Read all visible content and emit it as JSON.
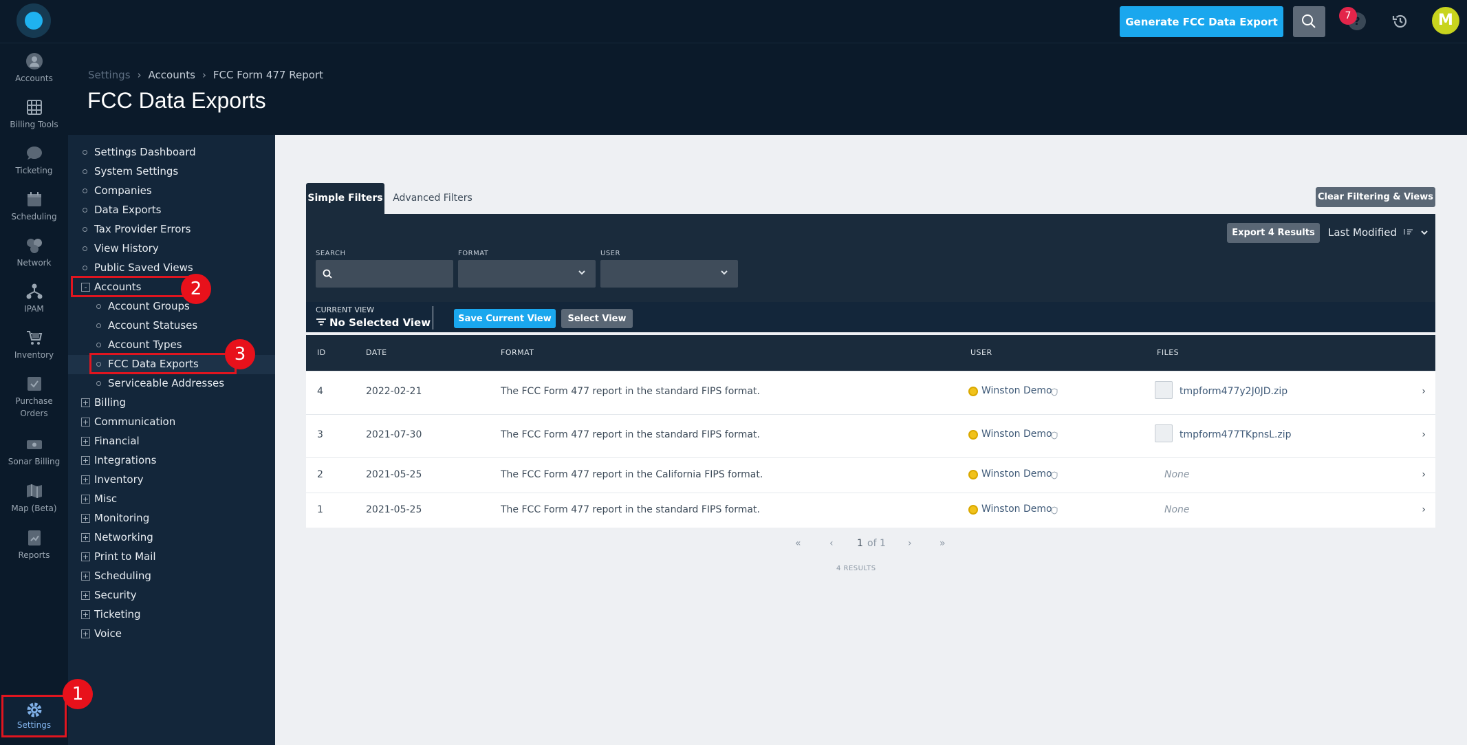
{
  "topbar": {
    "generate_label": "Generate FCC Data Export",
    "notification_count": "7",
    "help_glyph": "?",
    "avatar_initial": "M"
  },
  "rail": {
    "items": [
      {
        "label": "Accounts",
        "icon": "user-icon"
      },
      {
        "label": "Billing Tools",
        "icon": "abacus-icon"
      },
      {
        "label": "Ticketing",
        "icon": "chat-bubble-icon"
      },
      {
        "label": "Scheduling",
        "icon": "calendar-icon"
      },
      {
        "label": "Network",
        "icon": "network-icon"
      },
      {
        "label": "IPAM",
        "icon": "ipam-tree-icon"
      },
      {
        "label": "Inventory",
        "icon": "cart-icon"
      },
      {
        "label": "Purchase",
        "label2": "Orders",
        "icon": "purchase-order-icon"
      },
      {
        "label": "Sonar Billing",
        "icon": "sonar-billing-icon"
      },
      {
        "label": "Map (Beta)",
        "icon": "map-icon"
      },
      {
        "label": "Reports",
        "icon": "reports-icon"
      }
    ],
    "settings_label": "Settings"
  },
  "markers": [
    "1",
    "2",
    "3"
  ],
  "breadcrumb": [
    "Settings",
    "Accounts",
    "FCC Form 477 Report"
  ],
  "page_title": "FCC Data Exports",
  "subnav": {
    "top_items": [
      "Settings Dashboard",
      "System Settings",
      "Companies",
      "Data Exports",
      "Tax Provider Errors",
      "View History",
      "Public Saved Views"
    ],
    "accounts": {
      "label": "Accounts",
      "toggle": "-",
      "children": [
        "Account Groups",
        "Account Statuses",
        "Account Types",
        "FCC Data Exports",
        "Serviceable Addresses"
      ]
    },
    "sections": [
      "Billing",
      "Communication",
      "Financial",
      "Integrations",
      "Inventory",
      "Misc",
      "Monitoring",
      "Networking",
      "Print to Mail",
      "Scheduling",
      "Security",
      "Ticketing",
      "Voice"
    ],
    "toggle_plus": "+"
  },
  "main": {
    "tabs": {
      "simple": "Simple Filters",
      "advanced": "Advanced Filters"
    },
    "clear_label": "Clear Filtering & Views",
    "export_label": "Export 4 Results",
    "sort_label": "Last Modified",
    "filters": {
      "search": "SEARCH",
      "format": "FORMAT",
      "user": "USER"
    },
    "current_view_label": "CURRENT VIEW",
    "current_view_value": "No Selected View",
    "save_view_label": "Save Current View",
    "select_view_label": "Select View"
  },
  "table": {
    "headers": {
      "id": "ID",
      "date": "DATE",
      "format": "FORMAT",
      "user": "USER",
      "files": "FILES"
    },
    "rows": [
      {
        "id": "4",
        "date": "2022-02-21",
        "format": "The FCC Form 477 report in the standard FIPS format.",
        "user": "Winston Demo",
        "file": "tmpform477y2J0JD.zip"
      },
      {
        "id": "3",
        "date": "2021-07-30",
        "format": "The FCC Form 477 report in the standard FIPS format.",
        "user": "Winston Demo",
        "file": "tmpform477TKpnsL.zip"
      },
      {
        "id": "2",
        "date": "2021-05-25",
        "format": "The FCC Form 477 report in the California FIPS format.",
        "user": "Winston Demo",
        "file": "None"
      },
      {
        "id": "1",
        "date": "2021-05-25",
        "format": "The FCC Form 477 report in the standard FIPS format.",
        "user": "Winston Demo",
        "file": "None"
      }
    ]
  },
  "pager": {
    "first": "«",
    "prev": "‹",
    "page": "1",
    "of": "of 1",
    "next": "›",
    "last": "»",
    "results": "4 RESULTS"
  }
}
